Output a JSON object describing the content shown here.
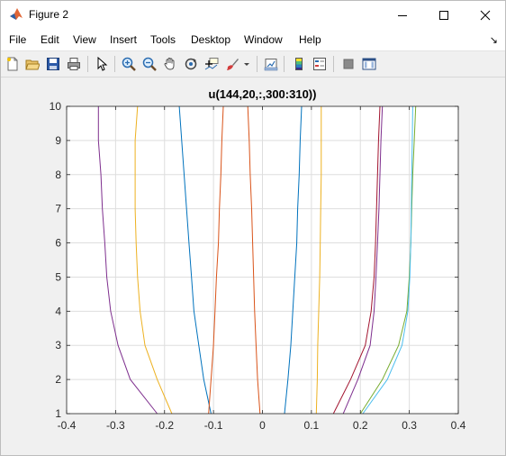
{
  "window": {
    "title": "Figure 2"
  },
  "menu": [
    "File",
    "Edit",
    "View",
    "Insert",
    "Tools",
    "Desktop",
    "Window",
    "Help"
  ],
  "toolbar": [
    "new-figure",
    "open-file",
    "save",
    "print",
    "edit-plot",
    "zoom-in",
    "zoom-out",
    "pan",
    "rotate-3d",
    "data-cursor",
    "brush",
    "link-plot",
    "insert-colorbar",
    "insert-legend",
    "hide-plot-tools",
    "show-plot-tools"
  ],
  "chart_data": {
    "type": "line",
    "title": "u(144,20,:,300:310))",
    "xlabel": "",
    "ylabel": "",
    "xlim": [
      -0.4,
      0.4
    ],
    "ylim": [
      1,
      10
    ],
    "xticks": [
      "-0.4",
      "-0.3",
      "-0.2",
      "-0.1",
      "0",
      "0.1",
      "0.2",
      "0.3",
      "0.4"
    ],
    "yticks": [
      "1",
      "2",
      "3",
      "4",
      "5",
      "6",
      "7",
      "8",
      "9",
      "10"
    ],
    "grid": true,
    "series": [
      {
        "color": "#0072BD",
        "points": [
          [
            -0.105,
            1
          ],
          [
            -0.12,
            2
          ],
          [
            -0.13,
            3
          ],
          [
            -0.14,
            4
          ],
          [
            -0.145,
            5
          ],
          [
            -0.15,
            6
          ],
          [
            -0.155,
            7
          ],
          [
            -0.16,
            8
          ],
          [
            -0.165,
            9
          ],
          [
            -0.17,
            10
          ]
        ]
      },
      {
        "color": "#D95319",
        "points": [
          [
            -0.11,
            1
          ],
          [
            -0.105,
            2
          ],
          [
            -0.1,
            3
          ],
          [
            -0.097,
            4
          ],
          [
            -0.094,
            5
          ],
          [
            -0.09,
            6
          ],
          [
            -0.088,
            7
          ],
          [
            -0.085,
            8
          ],
          [
            -0.083,
            9
          ],
          [
            -0.08,
            10
          ]
        ]
      },
      {
        "color": "#EDB120",
        "points": [
          [
            -0.185,
            1
          ],
          [
            -0.215,
            2
          ],
          [
            -0.24,
            3
          ],
          [
            -0.25,
            4
          ],
          [
            -0.255,
            5
          ],
          [
            -0.258,
            6
          ],
          [
            -0.26,
            7
          ],
          [
            -0.26,
            8
          ],
          [
            -0.26,
            9
          ],
          [
            -0.255,
            10
          ]
        ]
      },
      {
        "color": "#7E2F8E",
        "points": [
          [
            -0.215,
            1
          ],
          [
            -0.27,
            2
          ],
          [
            -0.295,
            3
          ],
          [
            -0.31,
            4
          ],
          [
            -0.318,
            5
          ],
          [
            -0.322,
            6
          ],
          [
            -0.327,
            7
          ],
          [
            -0.33,
            8
          ],
          [
            -0.335,
            9
          ],
          [
            -0.335,
            10
          ]
        ]
      },
      {
        "color": "#77AC30",
        "points": [
          [
            0.2,
            1
          ],
          [
            0.245,
            2
          ],
          [
            0.278,
            3
          ],
          [
            0.295,
            4
          ],
          [
            0.3,
            5
          ],
          [
            0.303,
            6
          ],
          [
            0.305,
            7
          ],
          [
            0.307,
            8
          ],
          [
            0.31,
            9
          ],
          [
            0.313,
            10
          ]
        ]
      },
      {
        "color": "#4DBEEE",
        "points": [
          [
            0.205,
            1
          ],
          [
            0.255,
            2
          ],
          [
            0.285,
            3
          ],
          [
            0.297,
            4
          ],
          [
            0.301,
            5
          ],
          [
            0.303,
            6
          ],
          [
            0.304,
            7
          ],
          [
            0.305,
            8
          ],
          [
            0.306,
            9
          ],
          [
            0.307,
            10
          ]
        ]
      },
      {
        "color": "#A2142F",
        "points": [
          [
            0.145,
            1
          ],
          [
            0.18,
            2
          ],
          [
            0.21,
            3
          ],
          [
            0.222,
            4
          ],
          [
            0.228,
            5
          ],
          [
            0.231,
            6
          ],
          [
            0.233,
            7
          ],
          [
            0.235,
            8
          ],
          [
            0.237,
            9
          ],
          [
            0.24,
            10
          ]
        ]
      },
      {
        "color": "#0072BD",
        "points": [
          [
            0.045,
            1
          ],
          [
            0.052,
            2
          ],
          [
            0.058,
            3
          ],
          [
            0.062,
            4
          ],
          [
            0.066,
            5
          ],
          [
            0.07,
            6
          ],
          [
            0.072,
            7
          ],
          [
            0.075,
            8
          ],
          [
            0.077,
            9
          ],
          [
            0.08,
            10
          ]
        ]
      },
      {
        "color": "#D95319",
        "points": [
          [
            -0.005,
            1
          ],
          [
            -0.01,
            2
          ],
          [
            -0.013,
            3
          ],
          [
            -0.016,
            4
          ],
          [
            -0.018,
            5
          ],
          [
            -0.02,
            6
          ],
          [
            -0.022,
            7
          ],
          [
            -0.025,
            8
          ],
          [
            -0.027,
            9
          ],
          [
            -0.03,
            10
          ]
        ]
      },
      {
        "color": "#EDB120",
        "points": [
          [
            0.11,
            1
          ],
          [
            0.112,
            2
          ],
          [
            0.113,
            3
          ],
          [
            0.115,
            4
          ],
          [
            0.117,
            5
          ],
          [
            0.118,
            6
          ],
          [
            0.119,
            7
          ],
          [
            0.12,
            8
          ],
          [
            0.12,
            9
          ],
          [
            0.12,
            10
          ]
        ]
      },
      {
        "color": "#7E2F8E",
        "points": [
          [
            0.165,
            1
          ],
          [
            0.195,
            2
          ],
          [
            0.22,
            3
          ],
          [
            0.228,
            4
          ],
          [
            0.232,
            5
          ],
          [
            0.235,
            6
          ],
          [
            0.238,
            7
          ],
          [
            0.24,
            8
          ],
          [
            0.242,
            9
          ],
          [
            0.245,
            10
          ]
        ]
      }
    ]
  }
}
